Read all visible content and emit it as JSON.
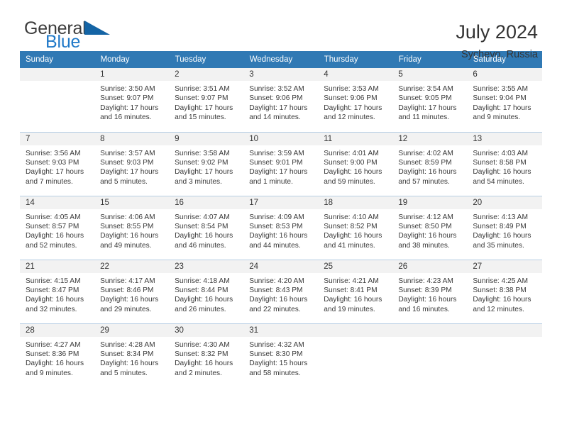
{
  "logo": {
    "word1": "General",
    "word2": "Blue",
    "triangle_color": "#1464a5",
    "blue_color": "#2079c8"
  },
  "header": {
    "title": "July 2024",
    "location": "Sychevo, Russia"
  },
  "theme": {
    "header_bg": "#3079b4",
    "daynum_bg": "#f2f2f2",
    "row_divider": "#b8cfe4",
    "text": "#333333"
  },
  "calendar": {
    "weekday_headers": [
      "Sunday",
      "Monday",
      "Tuesday",
      "Wednesday",
      "Thursday",
      "Friday",
      "Saturday"
    ],
    "weeks": [
      [
        {
          "day": "",
          "sunrise": "",
          "sunset": "",
          "daylight1": "",
          "daylight2": "",
          "empty": true
        },
        {
          "day": "1",
          "sunrise": "Sunrise: 3:50 AM",
          "sunset": "Sunset: 9:07 PM",
          "daylight1": "Daylight: 17 hours",
          "daylight2": "and 16 minutes."
        },
        {
          "day": "2",
          "sunrise": "Sunrise: 3:51 AM",
          "sunset": "Sunset: 9:07 PM",
          "daylight1": "Daylight: 17 hours",
          "daylight2": "and 15 minutes."
        },
        {
          "day": "3",
          "sunrise": "Sunrise: 3:52 AM",
          "sunset": "Sunset: 9:06 PM",
          "daylight1": "Daylight: 17 hours",
          "daylight2": "and 14 minutes."
        },
        {
          "day": "4",
          "sunrise": "Sunrise: 3:53 AM",
          "sunset": "Sunset: 9:06 PM",
          "daylight1": "Daylight: 17 hours",
          "daylight2": "and 12 minutes."
        },
        {
          "day": "5",
          "sunrise": "Sunrise: 3:54 AM",
          "sunset": "Sunset: 9:05 PM",
          "daylight1": "Daylight: 17 hours",
          "daylight2": "and 11 minutes."
        },
        {
          "day": "6",
          "sunrise": "Sunrise: 3:55 AM",
          "sunset": "Sunset: 9:04 PM",
          "daylight1": "Daylight: 17 hours",
          "daylight2": "and 9 minutes."
        }
      ],
      [
        {
          "day": "7",
          "sunrise": "Sunrise: 3:56 AM",
          "sunset": "Sunset: 9:03 PM",
          "daylight1": "Daylight: 17 hours",
          "daylight2": "and 7 minutes."
        },
        {
          "day": "8",
          "sunrise": "Sunrise: 3:57 AM",
          "sunset": "Sunset: 9:03 PM",
          "daylight1": "Daylight: 17 hours",
          "daylight2": "and 5 minutes."
        },
        {
          "day": "9",
          "sunrise": "Sunrise: 3:58 AM",
          "sunset": "Sunset: 9:02 PM",
          "daylight1": "Daylight: 17 hours",
          "daylight2": "and 3 minutes."
        },
        {
          "day": "10",
          "sunrise": "Sunrise: 3:59 AM",
          "sunset": "Sunset: 9:01 PM",
          "daylight1": "Daylight: 17 hours",
          "daylight2": "and 1 minute."
        },
        {
          "day": "11",
          "sunrise": "Sunrise: 4:01 AM",
          "sunset": "Sunset: 9:00 PM",
          "daylight1": "Daylight: 16 hours",
          "daylight2": "and 59 minutes."
        },
        {
          "day": "12",
          "sunrise": "Sunrise: 4:02 AM",
          "sunset": "Sunset: 8:59 PM",
          "daylight1": "Daylight: 16 hours",
          "daylight2": "and 57 minutes."
        },
        {
          "day": "13",
          "sunrise": "Sunrise: 4:03 AM",
          "sunset": "Sunset: 8:58 PM",
          "daylight1": "Daylight: 16 hours",
          "daylight2": "and 54 minutes."
        }
      ],
      [
        {
          "day": "14",
          "sunrise": "Sunrise: 4:05 AM",
          "sunset": "Sunset: 8:57 PM",
          "daylight1": "Daylight: 16 hours",
          "daylight2": "and 52 minutes."
        },
        {
          "day": "15",
          "sunrise": "Sunrise: 4:06 AM",
          "sunset": "Sunset: 8:55 PM",
          "daylight1": "Daylight: 16 hours",
          "daylight2": "and 49 minutes."
        },
        {
          "day": "16",
          "sunrise": "Sunrise: 4:07 AM",
          "sunset": "Sunset: 8:54 PM",
          "daylight1": "Daylight: 16 hours",
          "daylight2": "and 46 minutes."
        },
        {
          "day": "17",
          "sunrise": "Sunrise: 4:09 AM",
          "sunset": "Sunset: 8:53 PM",
          "daylight1": "Daylight: 16 hours",
          "daylight2": "and 44 minutes."
        },
        {
          "day": "18",
          "sunrise": "Sunrise: 4:10 AM",
          "sunset": "Sunset: 8:52 PM",
          "daylight1": "Daylight: 16 hours",
          "daylight2": "and 41 minutes."
        },
        {
          "day": "19",
          "sunrise": "Sunrise: 4:12 AM",
          "sunset": "Sunset: 8:50 PM",
          "daylight1": "Daylight: 16 hours",
          "daylight2": "and 38 minutes."
        },
        {
          "day": "20",
          "sunrise": "Sunrise: 4:13 AM",
          "sunset": "Sunset: 8:49 PM",
          "daylight1": "Daylight: 16 hours",
          "daylight2": "and 35 minutes."
        }
      ],
      [
        {
          "day": "21",
          "sunrise": "Sunrise: 4:15 AM",
          "sunset": "Sunset: 8:47 PM",
          "daylight1": "Daylight: 16 hours",
          "daylight2": "and 32 minutes."
        },
        {
          "day": "22",
          "sunrise": "Sunrise: 4:17 AM",
          "sunset": "Sunset: 8:46 PM",
          "daylight1": "Daylight: 16 hours",
          "daylight2": "and 29 minutes."
        },
        {
          "day": "23",
          "sunrise": "Sunrise: 4:18 AM",
          "sunset": "Sunset: 8:44 PM",
          "daylight1": "Daylight: 16 hours",
          "daylight2": "and 26 minutes."
        },
        {
          "day": "24",
          "sunrise": "Sunrise: 4:20 AM",
          "sunset": "Sunset: 8:43 PM",
          "daylight1": "Daylight: 16 hours",
          "daylight2": "and 22 minutes."
        },
        {
          "day": "25",
          "sunrise": "Sunrise: 4:21 AM",
          "sunset": "Sunset: 8:41 PM",
          "daylight1": "Daylight: 16 hours",
          "daylight2": "and 19 minutes."
        },
        {
          "day": "26",
          "sunrise": "Sunrise: 4:23 AM",
          "sunset": "Sunset: 8:39 PM",
          "daylight1": "Daylight: 16 hours",
          "daylight2": "and 16 minutes."
        },
        {
          "day": "27",
          "sunrise": "Sunrise: 4:25 AM",
          "sunset": "Sunset: 8:38 PM",
          "daylight1": "Daylight: 16 hours",
          "daylight2": "and 12 minutes."
        }
      ],
      [
        {
          "day": "28",
          "sunrise": "Sunrise: 4:27 AM",
          "sunset": "Sunset: 8:36 PM",
          "daylight1": "Daylight: 16 hours",
          "daylight2": "and 9 minutes."
        },
        {
          "day": "29",
          "sunrise": "Sunrise: 4:28 AM",
          "sunset": "Sunset: 8:34 PM",
          "daylight1": "Daylight: 16 hours",
          "daylight2": "and 5 minutes."
        },
        {
          "day": "30",
          "sunrise": "Sunrise: 4:30 AM",
          "sunset": "Sunset: 8:32 PM",
          "daylight1": "Daylight: 16 hours",
          "daylight2": "and 2 minutes."
        },
        {
          "day": "31",
          "sunrise": "Sunrise: 4:32 AM",
          "sunset": "Sunset: 8:30 PM",
          "daylight1": "Daylight: 15 hours",
          "daylight2": "and 58 minutes."
        },
        {
          "day": "",
          "sunrise": "",
          "sunset": "",
          "daylight1": "",
          "daylight2": "",
          "empty": true
        },
        {
          "day": "",
          "sunrise": "",
          "sunset": "",
          "daylight1": "",
          "daylight2": "",
          "empty": true
        },
        {
          "day": "",
          "sunrise": "",
          "sunset": "",
          "daylight1": "",
          "daylight2": "",
          "empty": true
        }
      ]
    ]
  }
}
